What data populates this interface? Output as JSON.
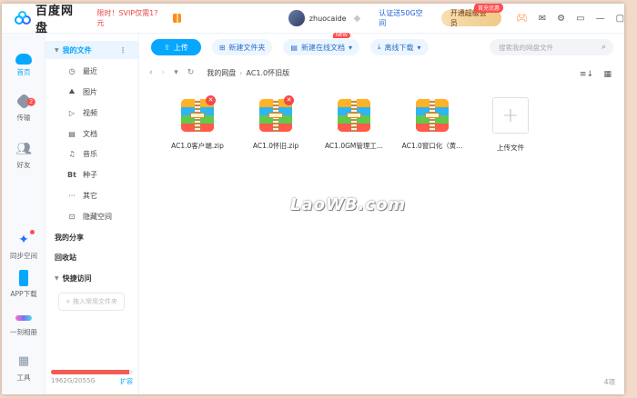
{
  "app": {
    "title": "百度网盘"
  },
  "header": {
    "promo": "限时！SVIP仅需1?元",
    "username": "zhuocaide",
    "verify": "认证送50G空间",
    "vip_button": "开通超级会员",
    "vip_tag": "首充优惠"
  },
  "nav": {
    "items": [
      {
        "label": "首页"
      },
      {
        "label": "传输",
        "badge": "2"
      },
      {
        "label": "好友"
      },
      {
        "label": "同步空间"
      },
      {
        "label": "APP下载"
      },
      {
        "label": "一刻相册"
      },
      {
        "label": "工具"
      }
    ]
  },
  "sidebar": {
    "my_files": "我的文件",
    "more": "⋮",
    "items": [
      {
        "label": "最近",
        "icon": "clock-icon",
        "glyph": "◷"
      },
      {
        "label": "图片",
        "icon": "mountain-icon",
        "glyph": "⛰"
      },
      {
        "label": "视频",
        "icon": "play-icon",
        "glyph": "▷"
      },
      {
        "label": "文档",
        "icon": "doc-icon",
        "glyph": "▤"
      },
      {
        "label": "音乐",
        "icon": "headphone-icon",
        "glyph": "♫"
      },
      {
        "label": "种子",
        "icon": "bt-icon",
        "glyph": "Bt"
      },
      {
        "label": "其它",
        "icon": "dots-icon",
        "glyph": "···"
      },
      {
        "label": "隐藏空间",
        "icon": "lock-icon",
        "glyph": "⊡"
      }
    ],
    "share": "我的分享",
    "recycle": "回收站",
    "quick": "快捷访问",
    "add_fav": "+ 拖入常用文件夹",
    "storage_text": "1962G/2055G",
    "storage_used": 1962,
    "storage_total": 2055,
    "expand": "扩容"
  },
  "toolbar": {
    "upload": "上传",
    "new_folder": "新建文件夹",
    "new_doc": "新建在线文档",
    "new_tag": "NEW",
    "offline": "离线下载",
    "search_placeholder": "搜索我的网盘文件"
  },
  "path": {
    "root": "我的网盘",
    "current": "AC1.0怀旧版"
  },
  "files": [
    {
      "name": "AC1.0客户端.zip",
      "badge": "✕"
    },
    {
      "name": "AC1.0怀旧.zip",
      "badge": "✕"
    },
    {
      "name": "AC1.0GM管理工..."
    },
    {
      "name": "AC1.0窗口化（黄..."
    }
  ],
  "upload_tile": {
    "icon": "+",
    "label": "上传文件"
  },
  "watermark": "LaoWB.com",
  "count": "4项",
  "colors": {
    "accent": "#06a7ff",
    "danger": "#ff4d4f",
    "vip": "#f0c986"
  }
}
